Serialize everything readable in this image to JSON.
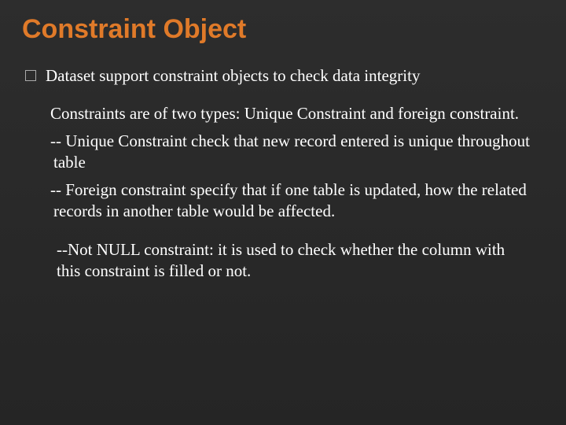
{
  "slide": {
    "title": "Constraint Object",
    "bullet": "Dataset support constraint objects to check data integrity",
    "para_intro": "Constraints are of two types: Unique Constraint and foreign constraint.",
    "para_unique": "-- Unique Constraint check that new record entered is unique throughout table",
    "para_foreign": "-- Foreign constraint specify that if one table is updated, how the related records in another table would be affected.",
    "para_notnull": "--Not NULL constraint: it is used to check whether the column with this constraint is filled or not."
  }
}
